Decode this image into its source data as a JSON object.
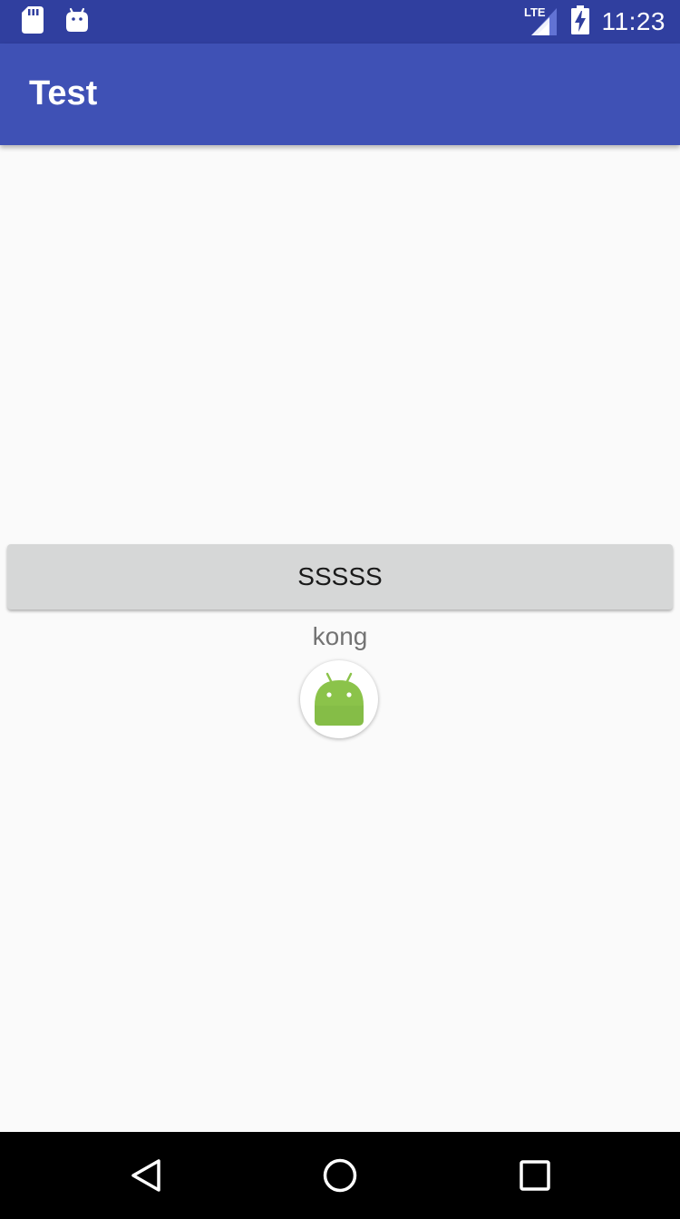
{
  "status_bar": {
    "time": "11:23",
    "network_label": "LTE",
    "left_icons": [
      "sd-card-icon",
      "android-debug-icon"
    ],
    "right_icons": [
      "lte-signal-icon",
      "battery-charging-icon"
    ],
    "color": "#303f9f"
  },
  "app_bar": {
    "title": "Test",
    "color": "#3f51b5"
  },
  "main": {
    "button_label": "SSSSS",
    "caption": "kong",
    "image_icon": "android-robot-icon"
  },
  "nav_bar": {
    "buttons": [
      "back-icon",
      "home-icon",
      "recents-icon"
    ]
  }
}
